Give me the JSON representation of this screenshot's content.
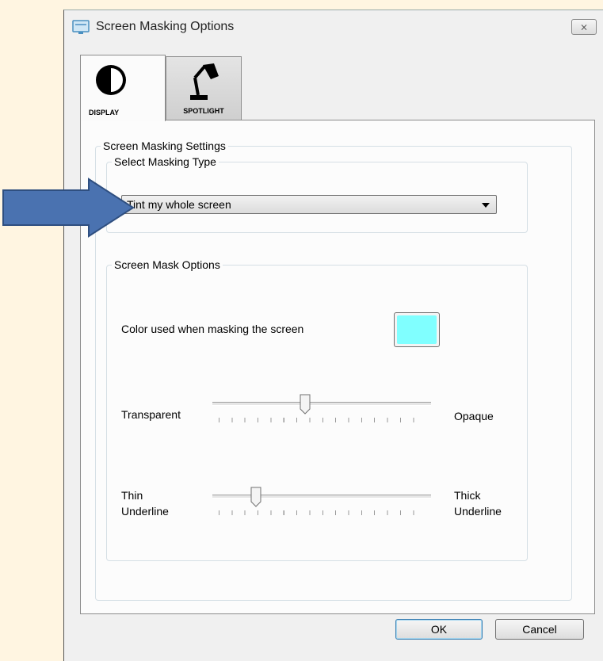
{
  "window": {
    "title": "Screen Masking Options",
    "close_glyph": "⨯"
  },
  "tabs": [
    {
      "label": "DISPLAY",
      "icon": "contrast-icon"
    },
    {
      "label": "SPOTLIGHT",
      "icon": "desk-lamp-icon"
    }
  ],
  "settings_group": {
    "legend": "Screen Masking Settings"
  },
  "masking_type": {
    "legend": "Select Masking Type",
    "selected": "Tint my whole screen"
  },
  "mask_options": {
    "legend": "Screen Mask Options",
    "color_label": "Color used when masking the screen",
    "color": "#80ffff",
    "opacity": {
      "left_label": "Transparent",
      "right_label": "Opaque",
      "value_percent": 42
    },
    "underline": {
      "left_label_1": "Thin",
      "left_label_2": "Underline",
      "right_label_1": "Thick",
      "right_label_2": "Underline",
      "value_percent": 18
    }
  },
  "buttons": {
    "ok": "OK",
    "cancel": "Cancel"
  },
  "colors": {
    "background": "#fff5e1",
    "arrow_fill": "#4a72b0",
    "arrow_stroke": "#2f4f80"
  }
}
